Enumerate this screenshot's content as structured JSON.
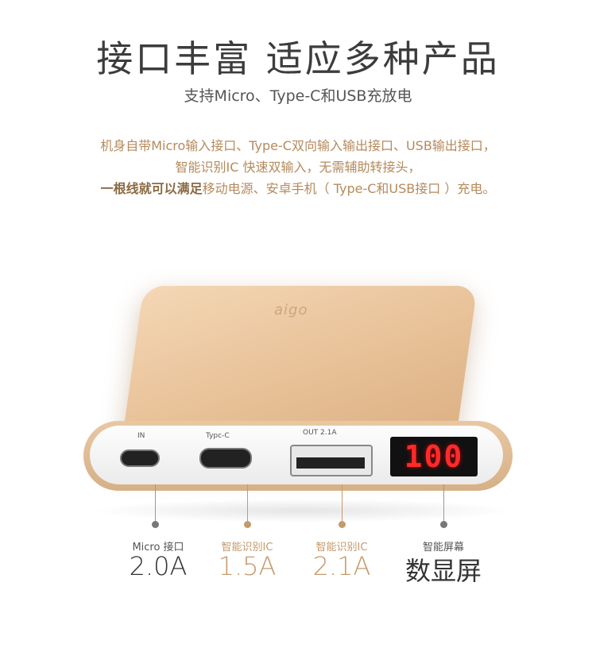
{
  "header": {
    "title": "接口丰富  适应多种产品",
    "subtitle": "支持Micro、Type-C和USB充放电"
  },
  "description": {
    "line1": "机身自带Micro输入接口、Type-C双向输入输出接口、USB输出接口，",
    "line2": "智能识别IC  快速双输入，无需辅助转接头，",
    "line3_strong": "一根线就可以满足",
    "line3_rest": "移动电源、安卓手机（ Type-C和USB接口 ）充电。"
  },
  "device": {
    "logo": "aigo",
    "ports": {
      "in_label": "IN",
      "typec_label": "Typc-C",
      "usb_label": "OUT 2.1A",
      "display_value": "100"
    }
  },
  "callouts": [
    {
      "label": "Micro 接口",
      "value": "2.0A",
      "color": "#333333",
      "dot": "#777777"
    },
    {
      "label": "智能识别IC",
      "value": "1.5A",
      "color": "#c49a6c",
      "dot": "#c49a6c"
    },
    {
      "label": "智能识别IC",
      "value": "2.1A",
      "color": "#c49a6c",
      "dot": "#c49a6c"
    },
    {
      "label": "智能屏幕",
      "value": "数显屏",
      "color": "#333333",
      "dot": "#777777"
    }
  ]
}
